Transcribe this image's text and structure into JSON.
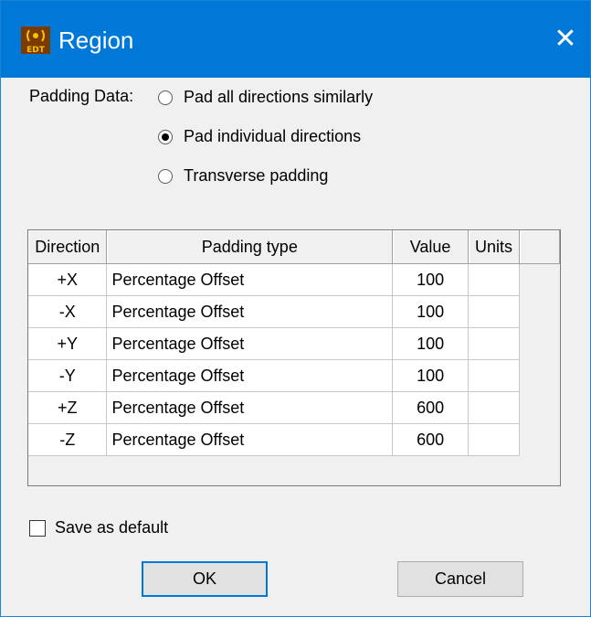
{
  "window": {
    "title": "Region",
    "app_icon": "edt-icon",
    "accent": "#0078d7"
  },
  "padding": {
    "label": "Padding Data:",
    "options": [
      {
        "label": "Pad all directions similarly",
        "selected": false
      },
      {
        "label": "Pad individual directions",
        "selected": true
      },
      {
        "label": "Transverse padding",
        "selected": false
      }
    ]
  },
  "table": {
    "headers": [
      "Direction",
      "Padding type",
      "Value",
      "Units"
    ],
    "rows": [
      {
        "direction": "+X",
        "type": "Percentage Offset",
        "value": "100",
        "units": ""
      },
      {
        "direction": "-X",
        "type": "Percentage Offset",
        "value": "100",
        "units": ""
      },
      {
        "direction": "+Y",
        "type": "Percentage Offset",
        "value": "100",
        "units": ""
      },
      {
        "direction": "-Y",
        "type": "Percentage Offset",
        "value": "100",
        "units": ""
      },
      {
        "direction": "+Z",
        "type": "Percentage Offset",
        "value": "600",
        "units": ""
      },
      {
        "direction": "-Z",
        "type": "Percentage Offset",
        "value": "600",
        "units": ""
      }
    ]
  },
  "save_default": {
    "label": "Save as default",
    "checked": false
  },
  "buttons": {
    "ok": "OK",
    "cancel": "Cancel"
  }
}
